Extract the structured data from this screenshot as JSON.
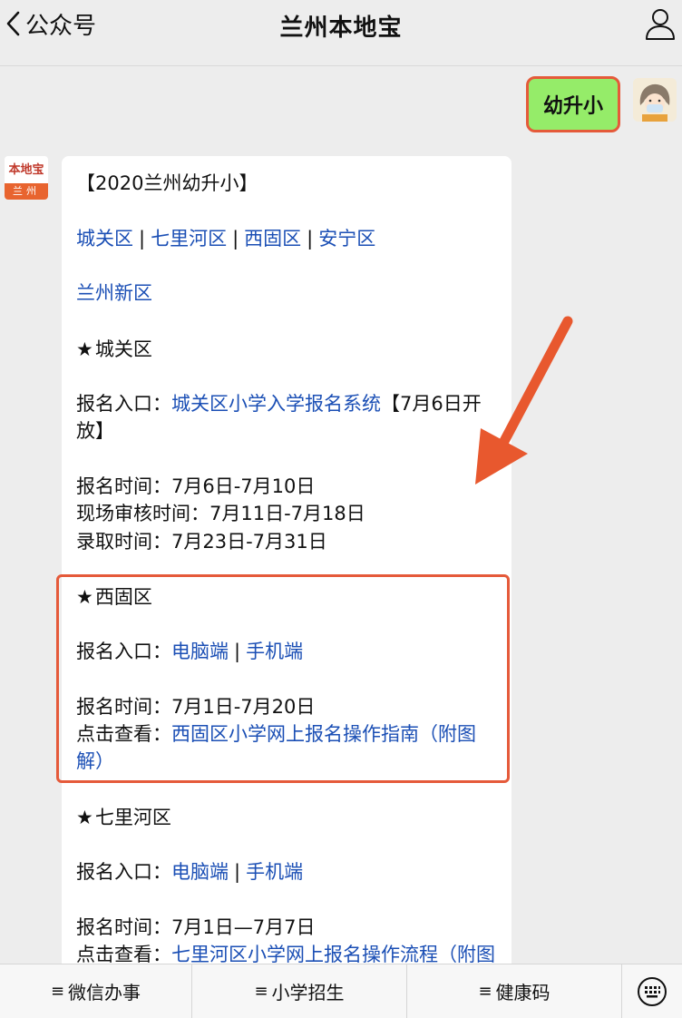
{
  "header": {
    "back_label": "公众号",
    "title": "兰州本地宝"
  },
  "user_message": "幼升小",
  "bot_avatar": {
    "logo_text": "本地宝",
    "city": "兰州"
  },
  "article": {
    "heading": "【2020兰州幼升小】",
    "districts": [
      "城关区",
      "七里河区",
      "西固区",
      "安宁区"
    ],
    "district_extra": "兰州新区",
    "chengguan": {
      "title": "城关区",
      "entry_label": "报名入口：",
      "entry_link": "城关区小学入学报名系统",
      "entry_note_1": "【7月6日开",
      "entry_note_2": "放】",
      "reg_time": "报名时间：7月6日-7月10日",
      "review_time": "现场审核时间：7月11日-7月18日",
      "admit_time": "录取时间：7月23日-7月31日"
    },
    "xigu": {
      "title": "西固区",
      "entry_label": "报名入口：",
      "link_pc": "电脑端",
      "link_mobile": "手机端",
      "reg_time": "报名时间：7月1日-7月20日",
      "guide_label": "点击查看：",
      "guide_link_1": "西固区小学网上报名操作指南（附图",
      "guide_link_2": "解）"
    },
    "qilihe": {
      "title": "七里河区",
      "entry_label": "报名入口：",
      "link_pc": "电脑端",
      "link_mobile": "手机端",
      "reg_time": "报名时间：7月1日—7月7日",
      "guide_label": "点击查看：",
      "guide_link": "七里河区小学网上报名操作流程（附图"
    }
  },
  "bottom_menu": [
    "微信办事",
    "小学招生",
    "健康码"
  ],
  "colors": {
    "link": "#1b4fb5",
    "highlight": "#e55a3a",
    "bubble": "#95ec69"
  }
}
